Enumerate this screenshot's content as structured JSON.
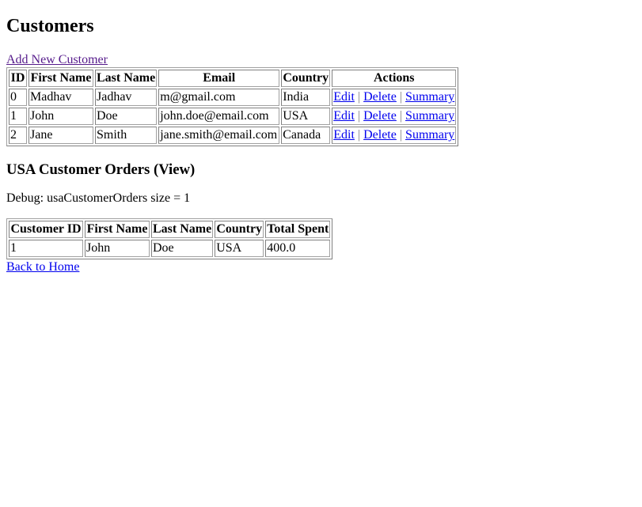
{
  "page": {
    "title": "Customers",
    "add_customer_link": "Add New Customer",
    "back_link": "Back to Home"
  },
  "customers_table": {
    "headers": [
      "ID",
      "First Name",
      "Last Name",
      "Email",
      "Country",
      "Actions"
    ],
    "rows": [
      {
        "id": "0",
        "first_name": "Madhav",
        "last_name": "Jadhav",
        "email": "m@gmail.com",
        "country": "India"
      },
      {
        "id": "1",
        "first_name": "John",
        "last_name": "Doe",
        "email": "john.doe@email.com",
        "country": "USA"
      },
      {
        "id": "2",
        "first_name": "Jane",
        "last_name": "Smith",
        "email": "jane.smith@email.com",
        "country": "Canada"
      }
    ],
    "actions": {
      "edit": "Edit",
      "delete": "Delete",
      "summary": "Summary",
      "separator": "|"
    }
  },
  "orders_section": {
    "title": "USA Customer Orders (View)",
    "debug_text": "Debug: usaCustomerOrders size = 1",
    "headers": [
      "Customer ID",
      "First Name",
      "Last Name",
      "Country",
      "Total Spent"
    ],
    "rows": [
      {
        "customer_id": "1",
        "first_name": "John",
        "last_name": "Doe",
        "country": "USA",
        "total_spent": "400.0"
      }
    ]
  },
  "colors": {
    "link": "#0000ee",
    "visited_link": "#551a8b",
    "border": "#808080"
  }
}
